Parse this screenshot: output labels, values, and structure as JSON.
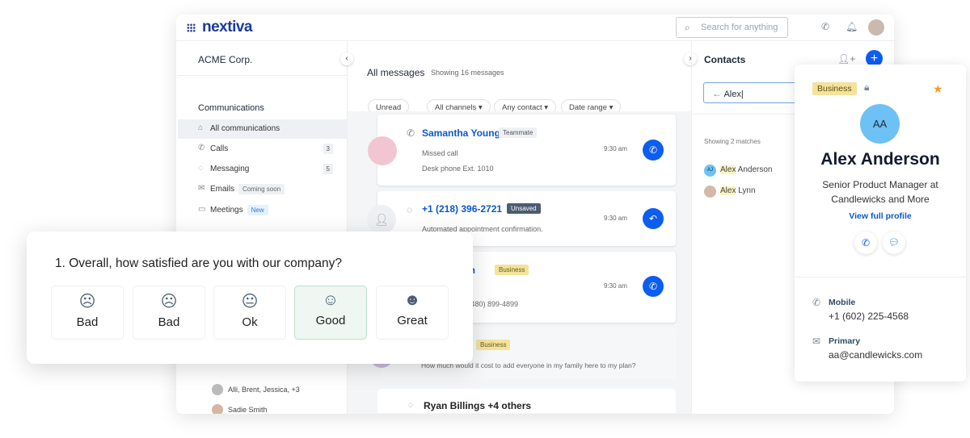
{
  "header": {
    "logo": "nextiva",
    "search_placeholder": "Search for anything"
  },
  "sidebar": {
    "org": "ACME Corp.",
    "section": "Communications",
    "items": [
      {
        "label": "All communications",
        "icon": "inbox-icon"
      },
      {
        "label": "Calls",
        "count": "3",
        "icon": "phone-icon"
      },
      {
        "label": "Messaging",
        "count": "5",
        "icon": "chat-icon"
      },
      {
        "label": "Emails",
        "tag": "Coming soon",
        "icon": "mail-icon"
      },
      {
        "label": "Meetings",
        "tag": "New",
        "icon": "video-icon"
      }
    ],
    "lower": [
      "Alli, Brent, Jessica, +3",
      "Sadie Smith"
    ]
  },
  "messages": {
    "title": "All messages",
    "count": "Showing 16 messages",
    "filters": [
      "Unread",
      "All channels",
      "Any contact",
      "Date range"
    ],
    "cards": [
      {
        "name": "Samantha Young",
        "tag": "Teammate",
        "line1": "Missed call",
        "line2": "Desk phone Ext. 1010",
        "time": "9:30 am"
      },
      {
        "name": "+1 (218) 396-2721",
        "tag": "Unsaved",
        "line1": "Automated appointment confirmation.",
        "time": "9:30 am"
      },
      {
        "name": "rson",
        "tag": "Business",
        "line2": "1 (480) 899-4899",
        "time": "9:30 am"
      },
      {
        "tag": "Business",
        "line1": "How much would it cost to add everyone in my family here to my plan?"
      },
      {
        "name": "Ryan Billings +4 others"
      }
    ]
  },
  "contacts": {
    "title": "Contacts",
    "search_value": "Alex|",
    "matches": "Showing 2 matches",
    "results": [
      {
        "initials": "AJ",
        "hl": "Alex",
        "rest": " Anderson"
      },
      {
        "hl": "Alex",
        "rest": " Lynn"
      }
    ]
  },
  "profile": {
    "badge": "Business",
    "initials": "AA",
    "name": "Alex Anderson",
    "title": "Senior Product Manager at Candlewicks and More",
    "link": "View full profile",
    "mobile_label": "Mobile",
    "mobile": "+1 (602) 225-4568",
    "email_label": "Primary",
    "email": "aa@candlewicks.com"
  },
  "survey": {
    "question": "1. Overall, how satisfied are you with our company?",
    "options": [
      "Bad",
      "Bad",
      "Ok",
      "Good",
      "Great"
    ],
    "selected": "Good"
  },
  "colors": {
    "accent": "#0b5ef0",
    "badge": "#f3e39b",
    "selected": "#eef7f1"
  }
}
